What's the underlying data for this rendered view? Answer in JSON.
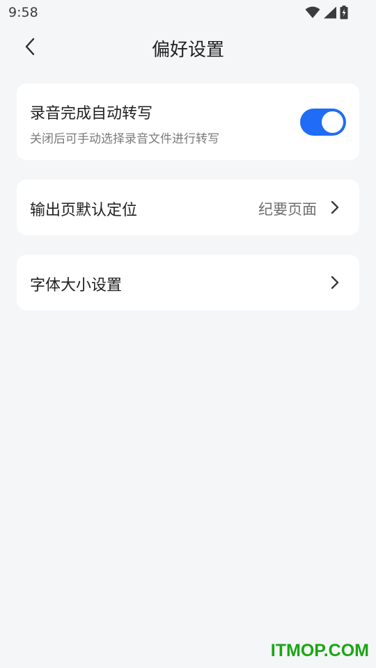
{
  "status_bar": {
    "time": "9:58",
    "icons": [
      "wifi-icon",
      "signal-icon",
      "battery-charging-icon"
    ]
  },
  "header": {
    "back_icon": "chevron-left-icon",
    "title": "偏好设置"
  },
  "settings": {
    "auto_transcribe": {
      "title": "录音完成自动转写",
      "subtitle": "关闭后可手动选择录音文件进行转写",
      "enabled": true
    },
    "output_page": {
      "title": "输出页默认定位",
      "value": "纪要页面",
      "icon": "chevron-right-icon"
    },
    "font_size": {
      "title": "字体大小设置",
      "icon": "chevron-right-icon"
    }
  },
  "watermark": {
    "text": "ITMOP.COM",
    "color": "#1aa614"
  },
  "colors": {
    "accent": "#1f6cf6",
    "background": "#f5f6f8",
    "card": "#ffffff"
  }
}
